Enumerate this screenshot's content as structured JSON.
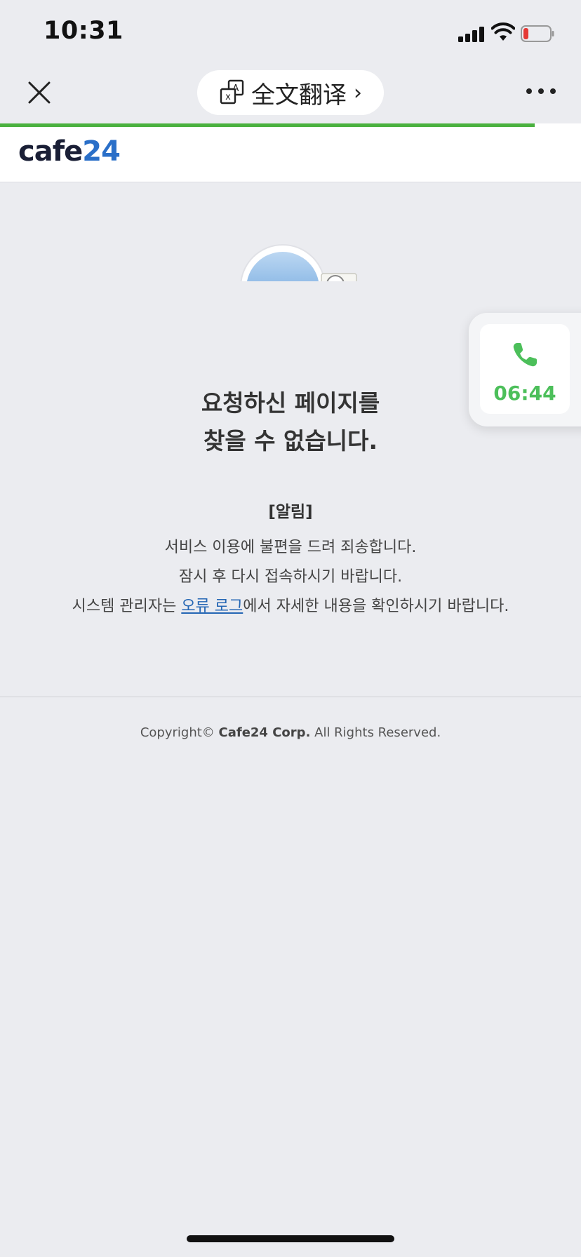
{
  "status_bar": {
    "time": "10:31"
  },
  "nav": {
    "translate_label": "全文翻译",
    "translate_chevron": "›",
    "page_load_progress": 0.92
  },
  "site": {
    "logo_part1": "cafe",
    "logo_part2": "24"
  },
  "call_widget": {
    "timer": "06:44"
  },
  "error": {
    "title_line1": "요청하신 페이지를",
    "title_line2": "찾을 수 없습니다."
  },
  "notice": {
    "heading": "[알림]",
    "line1": "서비스 이용에 불편을 드려 죄송합니다.",
    "line2": "잠시 후 다시 접속하시기 바랍니다.",
    "line3_prefix": "시스템 관리자는 ",
    "line3_link": "오류 로그",
    "line3_suffix": "에서 자세한 내용을 확인하시기 바랍니다."
  },
  "footer": {
    "prefix": "Copyright© ",
    "company": "Cafe24 Corp.",
    "suffix": " All Rights Reserved."
  },
  "colors": {
    "progress": "#4ab13f",
    "logo_accent": "#2a6fc8",
    "call_timer": "#4cbf5a",
    "link": "#2466b4",
    "background": "#ebecf0"
  }
}
